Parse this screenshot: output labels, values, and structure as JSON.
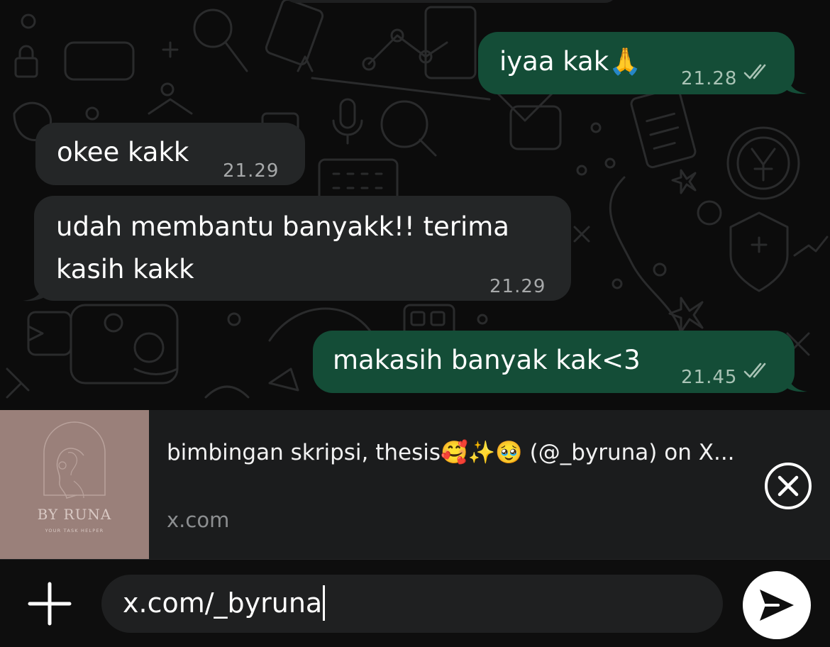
{
  "messages": [
    {
      "direction": "out",
      "text": "iyaa kak🙏",
      "time": "21.28",
      "status": "read"
    },
    {
      "direction": "in",
      "text": "okee kakk",
      "time": "21.29"
    },
    {
      "direction": "in",
      "text_line1": "udah membantu banyakk!! terima",
      "text_line2": "kasih kakk",
      "time": "21.29"
    },
    {
      "direction": "out",
      "text": "makasih banyak kak<3",
      "time": "21.45",
      "status": "read"
    }
  ],
  "link_preview": {
    "thumbnail_brand": "BY RUNA",
    "thumbnail_tagline": "YOUR TASK HELPER",
    "title": "bimbingan skripsi, thesis🥰✨🥹 (@_byruna) on X...",
    "domain": "x.com",
    "close_icon": "close-circle-icon"
  },
  "composer": {
    "value": "x.com/_byruna",
    "attach_icon": "plus-icon",
    "sticker_icon": "sticker-icon",
    "send_icon": "send-icon"
  },
  "colors": {
    "background": "#0c0c0c",
    "incoming_bubble": "#242627",
    "outgoing_bubble": "#144d37",
    "input_field": "#1f2021",
    "thumbnail": "#9a807a"
  }
}
